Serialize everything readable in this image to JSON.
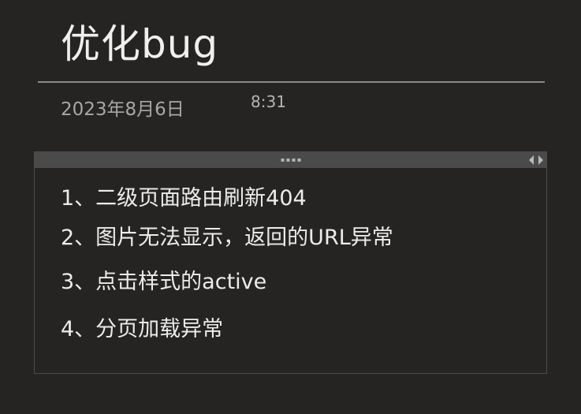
{
  "page": {
    "title": "优化bug",
    "date": "2023年8月6日",
    "time": "8:31"
  },
  "note": {
    "items": [
      "1、二级页面路由刷新404",
      "2、图片无法显示，返回的URL异常",
      "3、点击样式的active",
      "4、分页加载异常"
    ]
  },
  "colors": {
    "background": "#252423",
    "title_text": "#efefef",
    "meta_text": "#a8a8a8",
    "container_bar": "#4a4a4a",
    "container_border": "#4c4c4c"
  },
  "icons": {
    "drag_handle": "drag-handle-icon",
    "resize_left": "arrow-left-icon",
    "resize_right": "arrow-right-icon"
  }
}
